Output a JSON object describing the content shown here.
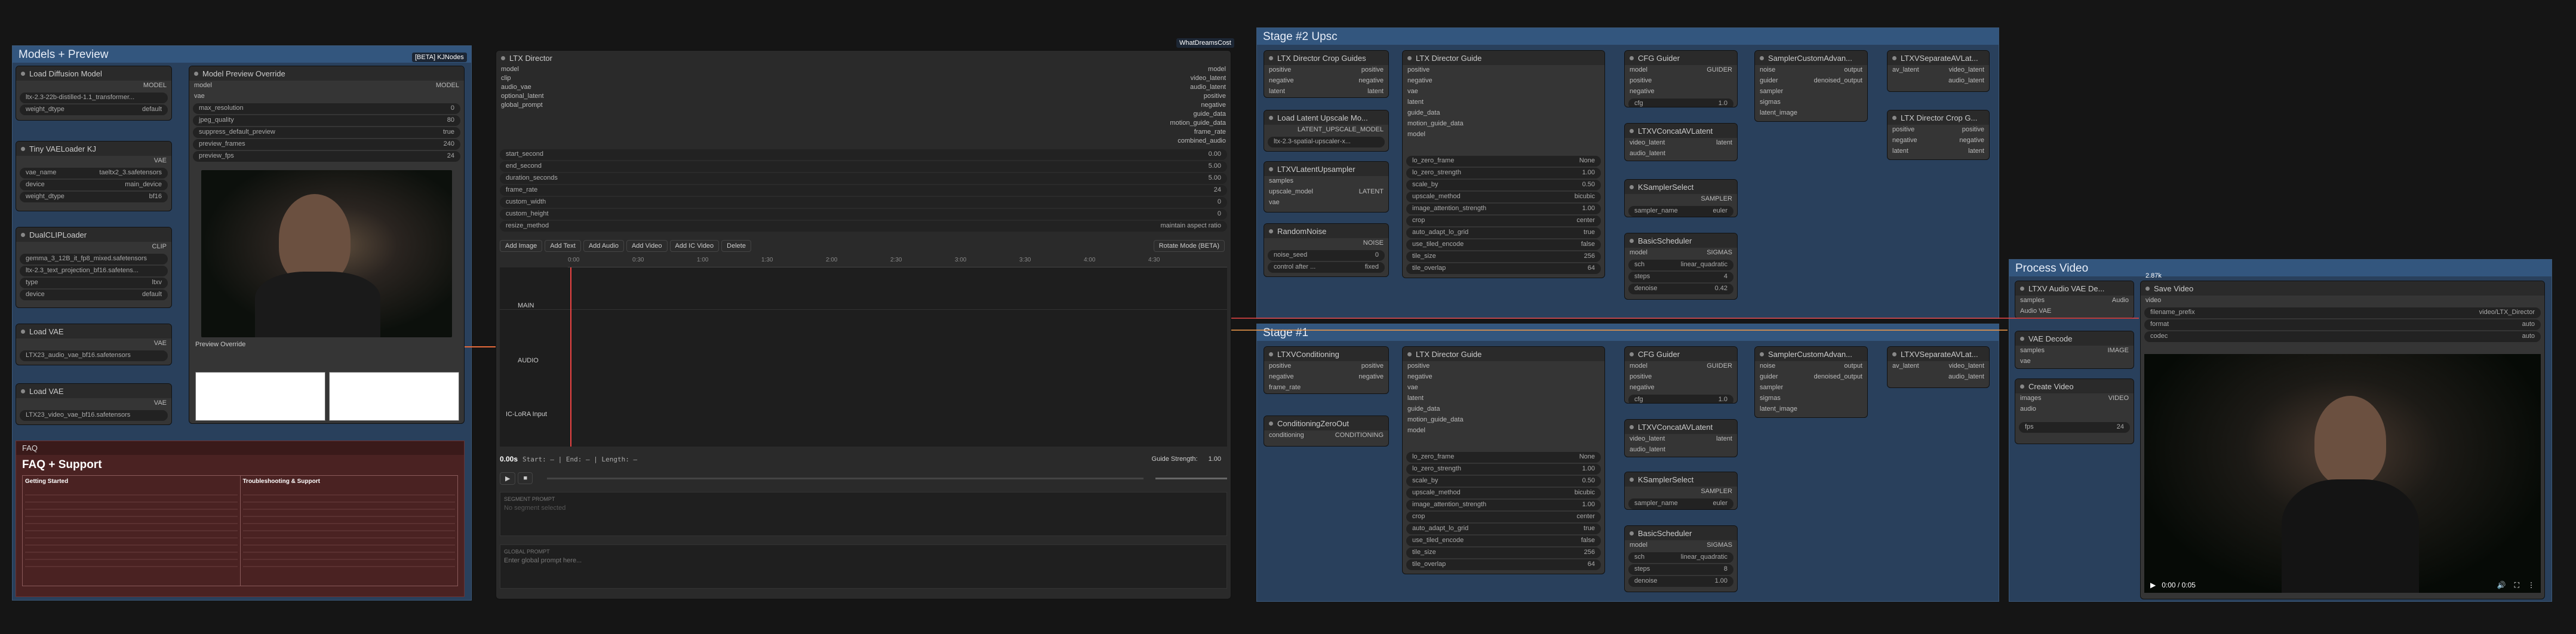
{
  "groups": {
    "models": "Models + Preview",
    "stage2": "Stage #2 Upsc",
    "stage1": "Stage #1",
    "process": "Process Video"
  },
  "nodes": {
    "load_diffusion": {
      "title": "Load Diffusion Model",
      "out": "MODEL",
      "name": "ltx-2.3-22b-distilled-1.1_transformer...",
      "dtype_label": "weight_dtype",
      "dtype": "default"
    },
    "tiny_vae": {
      "title": "Tiny VAELoader KJ",
      "out": "VAE",
      "name_label": "vae_name",
      "name": "taeltx2_3.safetensors",
      "device_label": "device",
      "device": "main_device",
      "dtype_label": "weight_dtype",
      "dtype": "bf16"
    },
    "dual_clip": {
      "title": "DualCLIPLoader",
      "out": "CLIP",
      "c1": "gemma_3_12B_it_fp8_mixed.safetensors",
      "c2": "ltx-2.3_text_projection_bf16.safetens...",
      "type_label": "type",
      "type": "ltxv",
      "device_label": "device",
      "device": "default"
    },
    "load_vae1": {
      "title": "Load VAE",
      "out": "VAE",
      "name": "LTX23_audio_vae_bf16.safetensors"
    },
    "load_vae2": {
      "title": "Load VAE",
      "out": "VAE",
      "name": "LTX23_video_vae_bf16.safetensors"
    },
    "preview_override": {
      "title": "Model Preview Override",
      "tag": "[BETA] KJNodes",
      "in1": "model",
      "in2": "vae",
      "out": "MODEL",
      "w1": "max_resolution",
      "v1": "0",
      "w2": "jpeg_quality",
      "v2": "80",
      "w3": "suppress_default_preview",
      "v3": "true",
      "w4": "preview_frames",
      "v4": "240",
      "w5": "preview_fps",
      "v5": "24",
      "caption": "Preview Override"
    },
    "ltx_director": {
      "title": "LTX Director",
      "inputs": [
        "model",
        "clip",
        "audio_vae",
        "optional_latent",
        "global_prompt"
      ],
      "outputs": [
        "model",
        "video_latent",
        "audio_latent",
        "positive",
        "negative",
        "guide_data",
        "motion_guide_data",
        "frame_rate",
        "combined_audio"
      ],
      "widgets": [
        [
          "start_second",
          "0.00"
        ],
        [
          "end_second",
          "5.00"
        ],
        [
          "duration_seconds",
          "5.00"
        ],
        [
          "frame_rate",
          "24"
        ],
        [
          "custom_width",
          "0"
        ],
        [
          "custom_height",
          "0"
        ],
        [
          "resize_method",
          "maintain aspect ratio"
        ]
      ],
      "buttons": [
        "Add Image",
        "Add Text",
        "Add Audio",
        "Add Video",
        "Add IC Video",
        "Delete"
      ],
      "rotate": "Rotate Mode (BETA)",
      "tracks": [
        "MAIN",
        "AUDIO",
        "IC-LoRA Input"
      ],
      "time": "0.00s",
      "range": "Start: — | End: — | Length: —",
      "guide_label": "Guide Strength:",
      "guide_val": "1.00",
      "segment_label": "SEGMENT PROMPT",
      "segment_ph": "No segment selected",
      "global_label": "GLOBAL PROMPT",
      "global_ph": "Enter global prompt here...",
      "ticks": [
        "0:00",
        "0:30",
        "1:00",
        "1:30",
        "2:00",
        "2:30",
        "3:00",
        "3:30",
        "4:00",
        "4:30"
      ]
    },
    "crop_guides": {
      "title": "LTX Director Crop Guides",
      "rows": [
        "positive",
        "negative",
        "latent"
      ]
    },
    "latent_upscale": {
      "title": "Load Latent Upscale Mo...",
      "out": "LATENT_UPSCALE_MODEL",
      "name": "ltx-2.3-spatial-upscaler-x..."
    },
    "latent_upsampler": {
      "title": "LTXVLatentUpsampler",
      "rows": [
        "samples",
        "upscale_model",
        "vae"
      ],
      "out": "LATENT"
    },
    "random_noise": {
      "title": "RandomNoise",
      "out": "NOISE",
      "w1": "noise_seed",
      "v1": "0",
      "w2": "control after ...",
      "v2": "fixed"
    },
    "guide2": {
      "title": "LTX Director Guide",
      "widgets": [
        [
          "lo_zero_frame",
          "None"
        ],
        [
          "lo_zero_strength",
          "1.00"
        ],
        [
          "scale_by",
          "0.50"
        ],
        [
          "upscale_method",
          "bicubic"
        ],
        [
          "image_attention_strength",
          "1.00"
        ],
        [
          "crop",
          "center"
        ],
        [
          "auto_adapt_lo_grid",
          "true"
        ],
        [
          "use_tiled_encode",
          "false"
        ],
        [
          "tile_size",
          "256"
        ],
        [
          "tile_overlap",
          "64"
        ]
      ]
    },
    "cfg2": {
      "title": "CFG Guider",
      "out": "GUIDER",
      "cfg": "1.0"
    },
    "concat2": {
      "title": "LTXVConcatAVLatent",
      "rows": [
        "video_latent",
        "audio_latent"
      ],
      "out": "latent"
    },
    "ksampler2": {
      "title": "KSamplerSelect",
      "out": "SAMPLER",
      "sampler": "euler"
    },
    "sched2": {
      "title": "BasicScheduler",
      "out": "SIGMAS",
      "sch": "linear_quadratic",
      "steps": "4",
      "denoise": "0.42"
    },
    "sca2": {
      "title": "SamplerCustomAdvan...",
      "rows": [
        "noise",
        "guider",
        "sampler",
        "sigmas",
        "latent_image"
      ],
      "out1": "output",
      "out2": "denoised_output"
    },
    "sep2": {
      "title": "LTXVSeparateAVLat...",
      "in": "av_latent",
      "out1": "video_latent",
      "out2": "audio_latent"
    },
    "crop_guides2": {
      "title": "LTX Director Crop G...",
      "rows": [
        "positive",
        "negative",
        "latent"
      ]
    },
    "conditioning": {
      "title": "LTXVConditioning",
      "rows": [
        "positive",
        "negative",
        "frame_rate"
      ]
    },
    "zero_out": {
      "title": "ConditioningZeroOut",
      "in": "conditioning",
      "out": "CONDITIONING"
    },
    "cfg1": {
      "cfg": "1.0"
    },
    "sched1": {
      "steps": "8",
      "denoise": "1.00"
    },
    "sep1": {
      "title": "LTXVSeparateAVLat..."
    },
    "audio_decode": {
      "title": "LTXV Audio VAE De...",
      "rows": [
        "samples",
        "Audio VAE"
      ],
      "out": "Audio"
    },
    "vae_decode": {
      "title": "VAE Decode",
      "rows": [
        "samples",
        "vae"
      ],
      "out": "IMAGE"
    },
    "create_video": {
      "title": "Create Video",
      "rows": [
        "images",
        "audio"
      ],
      "out": "VIDEO",
      "fps": "24"
    },
    "save_video": {
      "title": "Save Video",
      "in": "video",
      "w1": "filename_prefix",
      "v1": "video/LTX_Director",
      "w2": "format",
      "v2": "auto",
      "w3": "codec",
      "v3": "auto",
      "time": "0:00 / 0:05",
      "size": "2.87k"
    }
  },
  "faq": {
    "title": "FAQ",
    "heading": "FAQ + Support",
    "col1": "Getting Started",
    "col2": "Troubleshooting & Support"
  },
  "badges": {
    "wd": "WhatDreamsCost",
    "kj": "KJNodes"
  }
}
